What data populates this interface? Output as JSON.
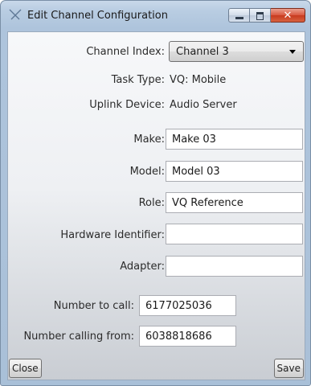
{
  "window": {
    "title": "Edit Channel Configuration",
    "controls": {
      "close_glyph": "✕"
    }
  },
  "form": {
    "channel_index": {
      "label": "Channel Index:",
      "value": "Channel 3"
    },
    "task_type": {
      "label": "Task Type:",
      "value": "VQ: Mobile"
    },
    "uplink_device": {
      "label": "Uplink Device:",
      "value": "Audio Server"
    },
    "make": {
      "label": "Make:",
      "value": "Make 03"
    },
    "model": {
      "label": "Model:",
      "value": "Model 03"
    },
    "role": {
      "label": "Role:",
      "value": "VQ Reference"
    },
    "hardware_identifier": {
      "label": "Hardware Identifier:",
      "value": ""
    },
    "adapter": {
      "label": "Adapter:",
      "value": ""
    },
    "number_to_call": {
      "label": "Number to call:",
      "value": "6177025036"
    },
    "number_calling_from": {
      "label": "Number calling from:",
      "value": "6038818686"
    }
  },
  "buttons": {
    "close": "Close",
    "save": "Save"
  }
}
